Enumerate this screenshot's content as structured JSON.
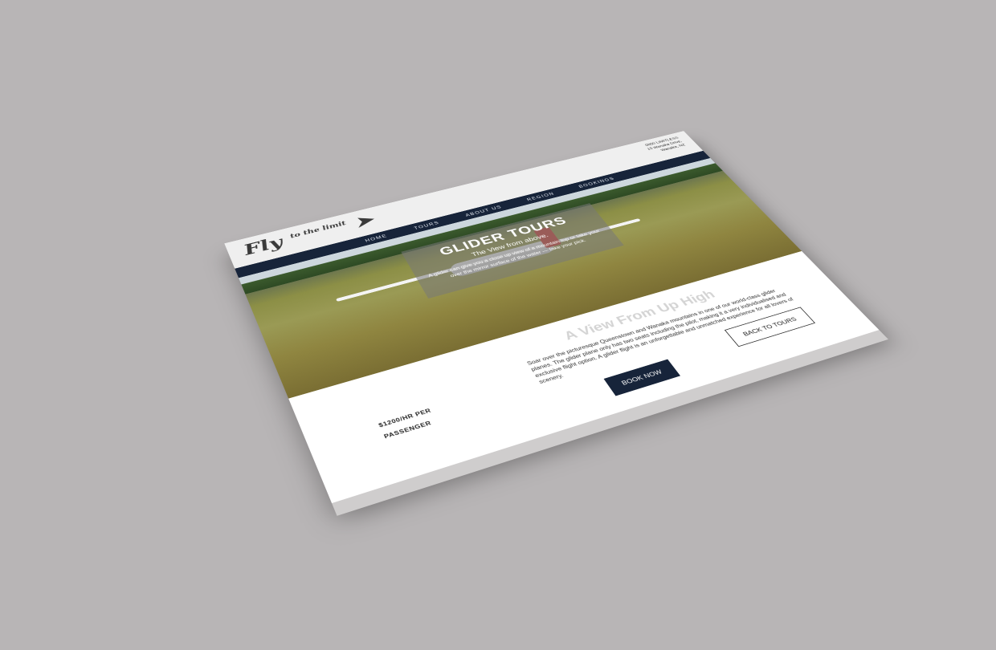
{
  "contact": {
    "line1": "0800 LIMITLESS",
    "line2": "15 Wanaka Drive,",
    "line3": "Wanaka, NZ"
  },
  "logo": {
    "main": "Fly",
    "small": "to the limit"
  },
  "nav": [
    {
      "label": "HOME"
    },
    {
      "label": "TOURS"
    },
    {
      "label": "ABOUT US"
    },
    {
      "label": "REGION"
    },
    {
      "label": "BOOKINGS"
    }
  ],
  "hero": {
    "title": "GLIDER TOURS",
    "subtitle": "The View from above.",
    "text": "A glider can give you a close up view of a mountain top or take your over the mirror surface of the water — take your pick."
  },
  "content": {
    "heading": "A View From Up High",
    "body": "Soar over the picturesque Queenstown and Wanaka mountains in one of our world-class glider planes. The glider plane only has two seats including the pilot, making it a very individualised and exclusive flight option. A glider flight is an unforgettable and unmatched experience for all lovers of scenery.",
    "price": "$1200/",
    "price_unit": "HR PER",
    "price_unit2": "PASSENGER",
    "book_label": "BOOK NOW",
    "back_label": "BACK TO TOURS"
  },
  "colors": {
    "navy": "#17243a",
    "background": "#b8b5b6",
    "grass": "#8f8540"
  }
}
